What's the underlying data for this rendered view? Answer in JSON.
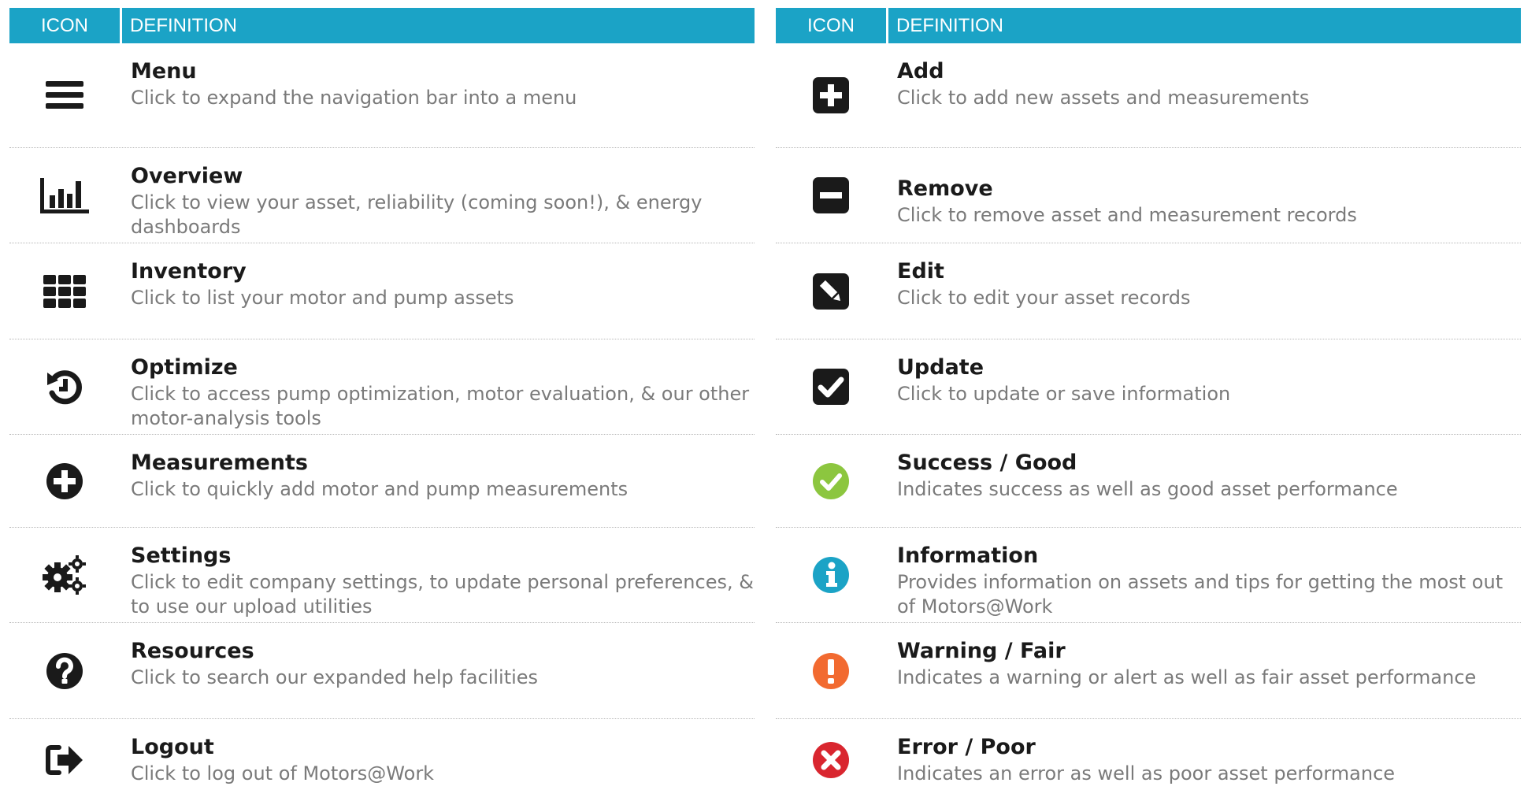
{
  "header": {
    "icon_label": "ICON",
    "definition_label": "DEFINITION"
  },
  "left_rows": [
    {
      "icon": "menu-icon",
      "title": "Menu",
      "desc": "Click to expand the navigation bar into a menu"
    },
    {
      "icon": "bar-chart-icon",
      "title": "Overview",
      "desc": "Click to view your asset, reliability (coming soon!), & energy dashboards"
    },
    {
      "icon": "grid-icon",
      "title": "Inventory",
      "desc": "Click to list your motor and pump assets"
    },
    {
      "icon": "history-icon",
      "title": "Optimize",
      "desc": "Click to access pump optimization, motor evaluation, & our other motor-analysis tools"
    },
    {
      "icon": "plus-circle-icon",
      "title": "Measurements",
      "desc": "Click to quickly add motor and pump measurements"
    },
    {
      "icon": "cogs-icon",
      "title": "Settings",
      "desc": "Click to edit company settings, to update personal preferences, & to use our upload utilities"
    },
    {
      "icon": "question-circle-icon",
      "title": "Resources",
      "desc": "Click to search our expanded help facilities"
    },
    {
      "icon": "sign-out-icon",
      "title": "Logout",
      "desc": "Click to log out of Motors@Work"
    }
  ],
  "right_rows": [
    {
      "icon": "plus-square-icon",
      "title": "Add",
      "desc": "Click to add new assets and measurements"
    },
    {
      "icon": "minus-square-icon",
      "title": "Remove",
      "desc": "Click to remove asset and measurement records"
    },
    {
      "icon": "pencil-square-icon",
      "title": "Edit",
      "desc": "Click to edit your asset records"
    },
    {
      "icon": "check-square-icon",
      "title": "Update",
      "desc": "Click to update or save information"
    },
    {
      "icon": "check-circle-icon",
      "title": "Success / Good",
      "desc": "Indicates success as well as good asset performance"
    },
    {
      "icon": "info-circle-icon",
      "title": "Information",
      "desc": "Provides information on assets and tips for getting the most out of Motors@Work"
    },
    {
      "icon": "exclamation-circle-icon",
      "title": "Warning / Fair",
      "desc": "Indicates a warning or alert as well as fair asset performance"
    },
    {
      "icon": "times-circle-icon",
      "title": "Error / Poor",
      "desc": "Indicates an error as well as poor asset performance"
    }
  ],
  "colors": {
    "header_bg": "#1ba3c6",
    "success": "#8cc63f",
    "info": "#1ba3c6",
    "warning": "#f26a30",
    "error": "#d9262f",
    "icon_dark": "#1a1a1a"
  }
}
